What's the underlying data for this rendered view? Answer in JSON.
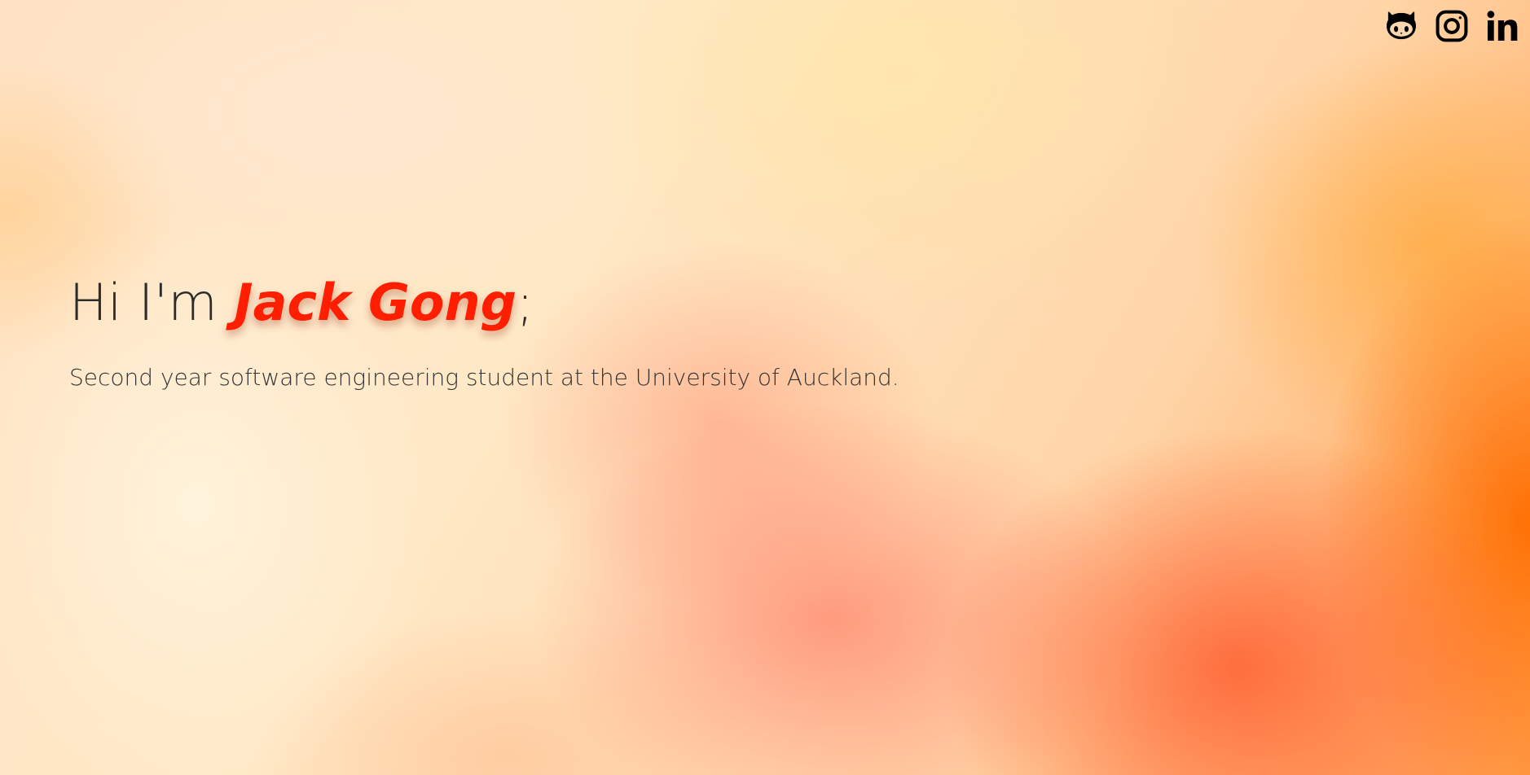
{
  "social": {
    "github_icon": "github-icon",
    "instagram_icon": "instagram-icon",
    "linkedin_icon": "linkedin-icon"
  },
  "hero": {
    "greeting": "Hi I'm ",
    "name": "Jack Gong",
    "terminator": ";",
    "tagline": "Second year software engineering student at the University of Auckland."
  },
  "colors": {
    "name_accent": "#ff1e00",
    "text": "#2c2c2c",
    "icons": "#000000"
  }
}
